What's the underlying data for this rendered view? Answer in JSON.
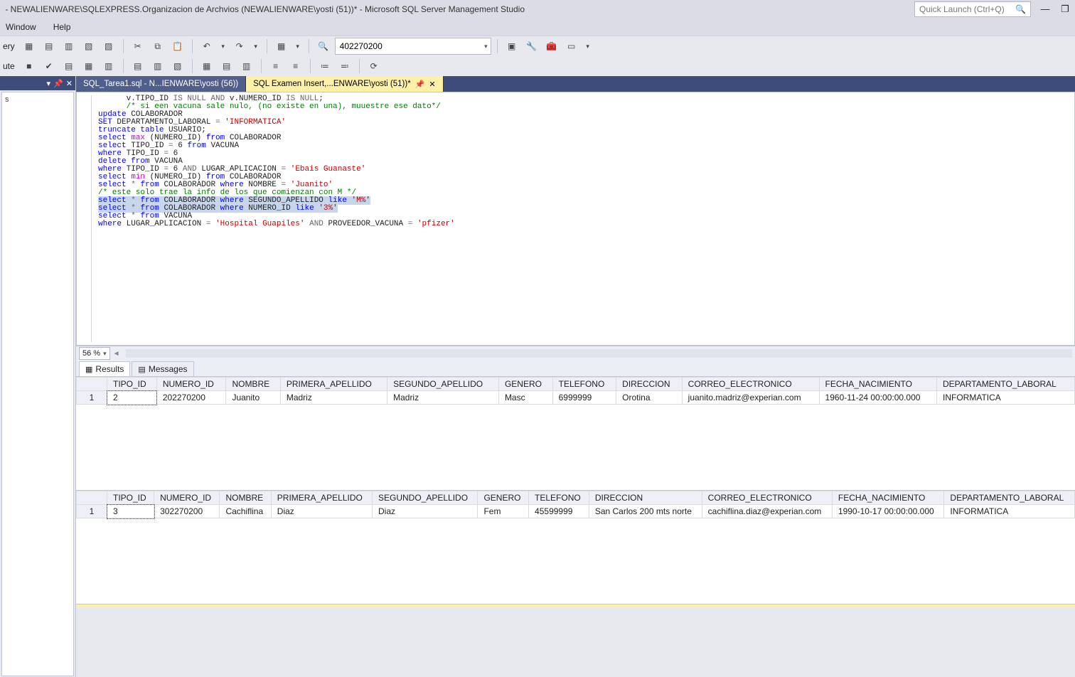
{
  "title": " - NEWALIENWARE\\SQLEXPRESS.Organizacion de Archvios (NEWALIENWARE\\yosti (51))* - Microsoft SQL Server Management Studio",
  "quick_launch_placeholder": "Quick Launch (Ctrl+Q)",
  "menu": {
    "items": [
      "Window",
      "Help"
    ]
  },
  "toolbar1": {
    "left_label": "ery",
    "search_value": "402270200"
  },
  "toolbar2": {
    "left_label": "ute"
  },
  "tabs": {
    "inactive": "SQL_Tarea1.sql - N...IENWARE\\yosti (56))",
    "active": "SQL Examen Insert,...ENWARE\\yosti (51))*"
  },
  "zoom": "56 %",
  "code_lines": [
    {
      "indent": 6,
      "parts": [
        {
          "t": "v.TIPO_ID "
        },
        {
          "t": "IS NULL AND",
          "c": "gray"
        },
        {
          "t": " v.NUMERO_ID "
        },
        {
          "t": "IS NULL",
          "c": "gray"
        },
        {
          "t": ";"
        }
      ]
    },
    {
      "indent": 6,
      "parts": [
        {
          "t": "/* si een vacuna sale nulo, (no existe en una), muuestre ese dato*/",
          "c": "cm"
        }
      ]
    },
    {
      "indent": 0,
      "parts": [
        {
          "t": ""
        }
      ]
    },
    {
      "indent": 0,
      "parts": [
        {
          "t": ""
        }
      ]
    },
    {
      "indent": 0,
      "mark": true,
      "parts": [
        {
          "t": "update",
          "c": "kw"
        },
        {
          "t": " COLABORADOR"
        }
      ]
    },
    {
      "indent": 0,
      "parts": [
        {
          "t": "SET",
          "c": "kw"
        },
        {
          "t": " DEPARTAMENTO_LABORAL "
        },
        {
          "t": "=",
          "c": "gray"
        },
        {
          "t": " "
        },
        {
          "t": "'INFORMATICA'",
          "c": "str"
        }
      ]
    },
    {
      "indent": 0,
      "parts": [
        {
          "t": ""
        }
      ]
    },
    {
      "indent": 0,
      "parts": [
        {
          "t": "truncate table",
          "c": "kw"
        },
        {
          "t": " USUARIO;"
        }
      ]
    },
    {
      "indent": 0,
      "parts": [
        {
          "t": "select ",
          "c": "kw"
        },
        {
          "t": "max",
          "c": "fn"
        },
        {
          "t": " (NUMERO_ID) "
        },
        {
          "t": "from",
          "c": "kw"
        },
        {
          "t": " COLABORADOR"
        }
      ]
    },
    {
      "indent": 0,
      "parts": [
        {
          "t": ""
        }
      ]
    },
    {
      "indent": 0,
      "mark": true,
      "parts": [
        {
          "t": "select",
          "c": "kw"
        },
        {
          "t": " TIPO_ID "
        },
        {
          "t": "=",
          "c": "gray"
        },
        {
          "t": " 6 "
        },
        {
          "t": "from",
          "c": "kw"
        },
        {
          "t": " VACUNA"
        }
      ]
    },
    {
      "indent": 0,
      "parts": [
        {
          "t": "where",
          "c": "kw"
        },
        {
          "t": " TIPO_ID "
        },
        {
          "t": "=",
          "c": "gray"
        },
        {
          "t": " 6"
        }
      ]
    },
    {
      "indent": 0,
      "parts": [
        {
          "t": ""
        }
      ]
    },
    {
      "indent": 0,
      "mark": true,
      "parts": [
        {
          "t": "delete from",
          "c": "kw"
        },
        {
          "t": " VACUNA"
        }
      ]
    },
    {
      "indent": 0,
      "parts": [
        {
          "t": "where",
          "c": "kw"
        },
        {
          "t": " TIPO_ID "
        },
        {
          "t": "=",
          "c": "gray"
        },
        {
          "t": " 6 "
        },
        {
          "t": "AND",
          "c": "gray"
        },
        {
          "t": " LUGAR_APLICACION "
        },
        {
          "t": "=",
          "c": "gray"
        },
        {
          "t": " "
        },
        {
          "t": "'Ebais Guanaste'",
          "c": "str"
        }
      ]
    },
    {
      "indent": 0,
      "parts": [
        {
          "t": ""
        }
      ]
    },
    {
      "indent": 0,
      "parts": [
        {
          "t": "select ",
          "c": "kw"
        },
        {
          "t": "min",
          "c": "fn"
        },
        {
          "t": " (NUMERO_ID) "
        },
        {
          "t": "from",
          "c": "kw"
        },
        {
          "t": " COLABORADOR"
        }
      ]
    },
    {
      "indent": 0,
      "parts": [
        {
          "t": ""
        }
      ]
    },
    {
      "indent": 0,
      "parts": [
        {
          "t": "select ",
          "c": "kw"
        },
        {
          "t": "*",
          "c": "gray"
        },
        {
          "t": " "
        },
        {
          "t": "from",
          "c": "kw"
        },
        {
          "t": " COLABORADOR "
        },
        {
          "t": "where",
          "c": "kw"
        },
        {
          "t": " NOMBRE "
        },
        {
          "t": "=",
          "c": "gray"
        },
        {
          "t": " "
        },
        {
          "t": "'Juanito'",
          "c": "str"
        }
      ]
    },
    {
      "indent": 0,
      "parts": [
        {
          "t": ""
        }
      ]
    },
    {
      "indent": 0,
      "parts": [
        {
          "t": "/* este solo trae la info de los que comienzan con M */",
          "c": "cm"
        }
      ]
    },
    {
      "indent": 0,
      "hl": true,
      "parts": [
        {
          "t": "select ",
          "c": "kw"
        },
        {
          "t": "*",
          "c": "gray"
        },
        {
          "t": " "
        },
        {
          "t": "from",
          "c": "kw"
        },
        {
          "t": " COLABORADOR "
        },
        {
          "t": "where",
          "c": "kw"
        },
        {
          "t": " SEGUNDO_APELLIDO "
        },
        {
          "t": "like",
          "c": "kw"
        },
        {
          "t": " "
        },
        {
          "t": "'M%'",
          "c": "str"
        }
      ]
    },
    {
      "indent": 0,
      "hl": true,
      "parts": [
        {
          "t": "select ",
          "c": "kw"
        },
        {
          "t": "*",
          "c": "gray"
        },
        {
          "t": " "
        },
        {
          "t": "from",
          "c": "kw"
        },
        {
          "t": " COLABORADOR "
        },
        {
          "t": "where",
          "c": "kw"
        },
        {
          "t": " NUMERO_ID "
        },
        {
          "t": "like",
          "c": "kw"
        },
        {
          "t": " "
        },
        {
          "t": "'3%'",
          "c": "str"
        }
      ]
    },
    {
      "indent": 0,
      "parts": [
        {
          "t": ""
        }
      ]
    },
    {
      "indent": 0,
      "mark": true,
      "parts": [
        {
          "t": "select ",
          "c": "kw"
        },
        {
          "t": "*",
          "c": "gray"
        },
        {
          "t": " "
        },
        {
          "t": "from",
          "c": "kw"
        },
        {
          "t": " VACUNA"
        }
      ]
    },
    {
      "indent": 0,
      "parts": [
        {
          "t": "where",
          "c": "kw"
        },
        {
          "t": " LUGAR_APLICACION "
        },
        {
          "t": "=",
          "c": "gray"
        },
        {
          "t": " "
        },
        {
          "t": "'Hospital Guapiles'",
          "c": "str"
        },
        {
          "t": " "
        },
        {
          "t": "AND",
          "c": "gray"
        },
        {
          "t": " PROVEEDOR_VACUNA "
        },
        {
          "t": "=",
          "c": "gray"
        },
        {
          "t": " "
        },
        {
          "t": "'pfizer'",
          "c": "str"
        }
      ]
    }
  ],
  "results_tabs": {
    "results": "Results",
    "messages": "Messages"
  },
  "grid1": {
    "cols": [
      "TIPO_ID",
      "NUMERO_ID",
      "NOMBRE",
      "PRIMERA_APELLIDO",
      "SEGUNDO_APELLIDO",
      "GENERO",
      "TELEFONO",
      "DIRECCION",
      "CORREO_ELECTRONICO",
      "FECHA_NACIMIENTO",
      "DEPARTAMENTO_LABORAL"
    ],
    "rows": [
      {
        "n": "1",
        "cells": [
          "2",
          "202270200",
          "Juanito",
          "Madriz",
          "Madriz",
          "Masc",
          "6999999",
          "Orotina",
          "juanito.madriz@experian.com",
          "1960-11-24 00:00:00.000",
          "INFORMATICA"
        ]
      }
    ]
  },
  "grid2": {
    "cols": [
      "TIPO_ID",
      "NUMERO_ID",
      "NOMBRE",
      "PRIMERA_APELLIDO",
      "SEGUNDO_APELLIDO",
      "GENERO",
      "TELEFONO",
      "DIRECCION",
      "CORREO_ELECTRONICO",
      "FECHA_NACIMIENTO",
      "DEPARTAMENTO_LABORAL"
    ],
    "rows": [
      {
        "n": "1",
        "cells": [
          "3",
          "302270200",
          "Cachiflina",
          "Diaz",
          "Diaz",
          "Fem",
          "45599999",
          "San Carlos 200 mts norte",
          "cachiflina.diaz@experian.com",
          "1990-10-17 00:00:00.000",
          "INFORMATICA"
        ]
      }
    ]
  }
}
